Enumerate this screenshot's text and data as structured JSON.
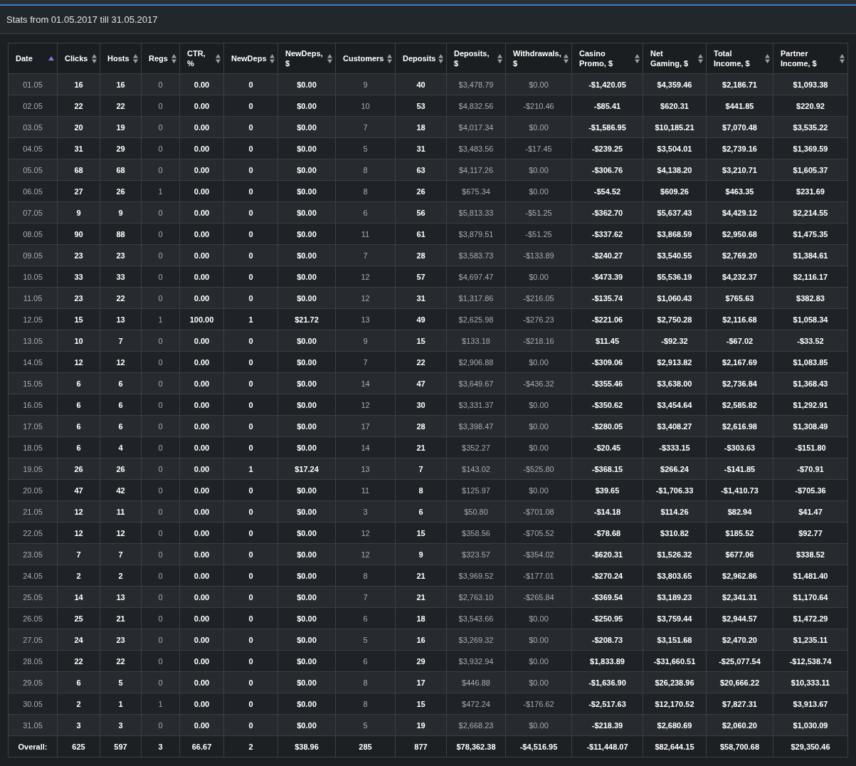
{
  "title": "Stats from 01.05.2017 till 31.05.2017",
  "table": {
    "columns": [
      {
        "label": "Date",
        "sorted": true,
        "muted": true
      },
      {
        "label": "Clicks",
        "sorted": false,
        "muted": false
      },
      {
        "label": "Hosts",
        "sorted": false,
        "muted": false
      },
      {
        "label": "Regs",
        "sorted": false,
        "muted": true
      },
      {
        "label": "CTR, %",
        "sorted": false,
        "muted": false
      },
      {
        "label": "NewDeps",
        "sorted": false,
        "muted": false
      },
      {
        "label": "NewDeps, $",
        "sorted": false,
        "muted": false
      },
      {
        "label": "Customers",
        "sorted": false,
        "muted": true
      },
      {
        "label": "Deposits",
        "sorted": false,
        "muted": false
      },
      {
        "label": "Deposits, $",
        "sorted": false,
        "muted": true
      },
      {
        "label": "Withdrawals, $",
        "sorted": false,
        "muted": true
      },
      {
        "label": "Casino Promo, $",
        "sorted": false,
        "muted": false
      },
      {
        "label": "Net Gaming, $",
        "sorted": false,
        "muted": false
      },
      {
        "label": "Total Income, $",
        "sorted": false,
        "muted": false
      },
      {
        "label": "Partner Income, $",
        "sorted": false,
        "muted": false
      }
    ],
    "rows": [
      [
        "01.05",
        "16",
        "16",
        "0",
        "0.00",
        "0",
        "$0.00",
        "9",
        "40",
        "$3,478.79",
        "$0.00",
        "-$1,420.05",
        "$4,359.46",
        "$2,186.71",
        "$1,093.38"
      ],
      [
        "02.05",
        "22",
        "22",
        "0",
        "0.00",
        "0",
        "$0.00",
        "10",
        "53",
        "$4,832.56",
        "-$210.46",
        "-$85.41",
        "$620.31",
        "$441.85",
        "$220.92"
      ],
      [
        "03.05",
        "20",
        "19",
        "0",
        "0.00",
        "0",
        "$0.00",
        "7",
        "18",
        "$4,017.34",
        "$0.00",
        "-$1,586.95",
        "$10,185.21",
        "$7,070.48",
        "$3,535.22"
      ],
      [
        "04.05",
        "31",
        "29",
        "0",
        "0.00",
        "0",
        "$0.00",
        "5",
        "31",
        "$3,483.56",
        "-$17.45",
        "-$239.25",
        "$3,504.01",
        "$2,739.16",
        "$1,369.59"
      ],
      [
        "05.05",
        "68",
        "68",
        "0",
        "0.00",
        "0",
        "$0.00",
        "8",
        "63",
        "$4,117.26",
        "$0.00",
        "-$306.76",
        "$4,138.20",
        "$3,210.71",
        "$1,605.37"
      ],
      [
        "06.05",
        "27",
        "26",
        "1",
        "0.00",
        "0",
        "$0.00",
        "8",
        "26",
        "$675.34",
        "$0.00",
        "-$54.52",
        "$609.26",
        "$463.35",
        "$231.69"
      ],
      [
        "07.05",
        "9",
        "9",
        "0",
        "0.00",
        "0",
        "$0.00",
        "6",
        "56",
        "$5,813.33",
        "-$51.25",
        "-$362.70",
        "$5,637.43",
        "$4,429.12",
        "$2,214.55"
      ],
      [
        "08.05",
        "90",
        "88",
        "0",
        "0.00",
        "0",
        "$0.00",
        "11",
        "61",
        "$3,879.51",
        "-$51.25",
        "-$337.62",
        "$3,868.59",
        "$2,950.68",
        "$1,475.35"
      ],
      [
        "09.05",
        "23",
        "23",
        "0",
        "0.00",
        "0",
        "$0.00",
        "7",
        "28",
        "$3,583.73",
        "-$133.89",
        "-$240.27",
        "$3,540.55",
        "$2,769.20",
        "$1,384.61"
      ],
      [
        "10.05",
        "33",
        "33",
        "0",
        "0.00",
        "0",
        "$0.00",
        "12",
        "57",
        "$4,697.47",
        "$0.00",
        "-$473.39",
        "$5,536.19",
        "$4,232.37",
        "$2,116.17"
      ],
      [
        "11.05",
        "23",
        "22",
        "0",
        "0.00",
        "0",
        "$0.00",
        "12",
        "31",
        "$1,317.86",
        "-$216.05",
        "-$135.74",
        "$1,060.43",
        "$765.63",
        "$382.83"
      ],
      [
        "12.05",
        "15",
        "13",
        "1",
        "100.00",
        "1",
        "$21.72",
        "13",
        "49",
        "$2,625.98",
        "-$276.23",
        "-$221.06",
        "$2,750.28",
        "$2,116.68",
        "$1,058.34"
      ],
      [
        "13.05",
        "10",
        "7",
        "0",
        "0.00",
        "0",
        "$0.00",
        "9",
        "15",
        "$133.18",
        "-$218.16",
        "$11.45",
        "-$92.32",
        "-$67.02",
        "-$33.52"
      ],
      [
        "14.05",
        "12",
        "12",
        "0",
        "0.00",
        "0",
        "$0.00",
        "7",
        "22",
        "$2,906.88",
        "$0.00",
        "-$309.06",
        "$2,913.82",
        "$2,167.69",
        "$1,083.85"
      ],
      [
        "15.05",
        "6",
        "6",
        "0",
        "0.00",
        "0",
        "$0.00",
        "14",
        "47",
        "$3,649.67",
        "-$436.32",
        "-$355.46",
        "$3,638.00",
        "$2,736.84",
        "$1,368.43"
      ],
      [
        "16.05",
        "6",
        "6",
        "0",
        "0.00",
        "0",
        "$0.00",
        "12",
        "30",
        "$3,331.37",
        "$0.00",
        "-$350.62",
        "$3,454.64",
        "$2,585.82",
        "$1,292.91"
      ],
      [
        "17.05",
        "6",
        "6",
        "0",
        "0.00",
        "0",
        "$0.00",
        "17",
        "28",
        "$3,398.47",
        "$0.00",
        "-$280.05",
        "$3,408.27",
        "$2,616.98",
        "$1,308.49"
      ],
      [
        "18.05",
        "6",
        "4",
        "0",
        "0.00",
        "0",
        "$0.00",
        "14",
        "21",
        "$352.27",
        "$0.00",
        "-$20.45",
        "-$333.15",
        "-$303.63",
        "-$151.80"
      ],
      [
        "19.05",
        "26",
        "26",
        "0",
        "0.00",
        "1",
        "$17.24",
        "13",
        "7",
        "$143.02",
        "-$525.80",
        "-$368.15",
        "$266.24",
        "-$141.85",
        "-$70.91"
      ],
      [
        "20.05",
        "47",
        "42",
        "0",
        "0.00",
        "0",
        "$0.00",
        "11",
        "8",
        "$125.97",
        "$0.00",
        "$39.65",
        "-$1,706.33",
        "-$1,410.73",
        "-$705.36"
      ],
      [
        "21.05",
        "12",
        "11",
        "0",
        "0.00",
        "0",
        "$0.00",
        "3",
        "6",
        "$50.80",
        "-$701.08",
        "-$14.18",
        "$114.26",
        "$82.94",
        "$41.47"
      ],
      [
        "22.05",
        "12",
        "12",
        "0",
        "0.00",
        "0",
        "$0.00",
        "12",
        "15",
        "$358.56",
        "-$705.52",
        "-$78.68",
        "$310.82",
        "$185.52",
        "$92.77"
      ],
      [
        "23.05",
        "7",
        "7",
        "0",
        "0.00",
        "0",
        "$0.00",
        "12",
        "9",
        "$323.57",
        "-$354.02",
        "-$620.31",
        "$1,526.32",
        "$677.06",
        "$338.52"
      ],
      [
        "24.05",
        "2",
        "2",
        "0",
        "0.00",
        "0",
        "$0.00",
        "8",
        "21",
        "$3,969.52",
        "-$177.01",
        "-$270.24",
        "$3,803.65",
        "$2,962.86",
        "$1,481.40"
      ],
      [
        "25.05",
        "14",
        "13",
        "0",
        "0.00",
        "0",
        "$0.00",
        "7",
        "21",
        "$2,763.10",
        "-$265.84",
        "-$369.54",
        "$3,189.23",
        "$2,341.31",
        "$1,170.64"
      ],
      [
        "26.05",
        "25",
        "21",
        "0",
        "0.00",
        "0",
        "$0.00",
        "6",
        "18",
        "$3,543.66",
        "$0.00",
        "-$250.95",
        "$3,759.44",
        "$2,944.57",
        "$1,472.29"
      ],
      [
        "27.05",
        "24",
        "23",
        "0",
        "0.00",
        "0",
        "$0.00",
        "5",
        "16",
        "$3,269.32",
        "$0.00",
        "-$208.73",
        "$3,151.68",
        "$2,470.20",
        "$1,235.11"
      ],
      [
        "28.05",
        "22",
        "22",
        "0",
        "0.00",
        "0",
        "$0.00",
        "6",
        "29",
        "$3,932.94",
        "$0.00",
        "$1,833.89",
        "-$31,660.51",
        "-$25,077.54",
        "-$12,538.74"
      ],
      [
        "29.05",
        "6",
        "5",
        "0",
        "0.00",
        "0",
        "$0.00",
        "8",
        "17",
        "$446.88",
        "$0.00",
        "-$1,636.90",
        "$26,238.96",
        "$20,666.22",
        "$10,333.11"
      ],
      [
        "30.05",
        "2",
        "1",
        "1",
        "0.00",
        "0",
        "$0.00",
        "8",
        "15",
        "$472.24",
        "-$176.62",
        "-$2,517.63",
        "$12,170.52",
        "$7,827.31",
        "$3,913.67"
      ],
      [
        "31.05",
        "3",
        "3",
        "0",
        "0.00",
        "0",
        "$0.00",
        "5",
        "19",
        "$2,668.23",
        "$0.00",
        "-$218.39",
        "$2,680.69",
        "$2,060.20",
        "$1,030.09"
      ]
    ],
    "totals": [
      "Overall:",
      "625",
      "597",
      "3",
      "66.67",
      "2",
      "$38.96",
      "285",
      "877",
      "$78,362.38",
      "-$4,516.95",
      "-$11,448.07",
      "$82,644.15",
      "$58,700.68",
      "$29,350.46"
    ]
  }
}
